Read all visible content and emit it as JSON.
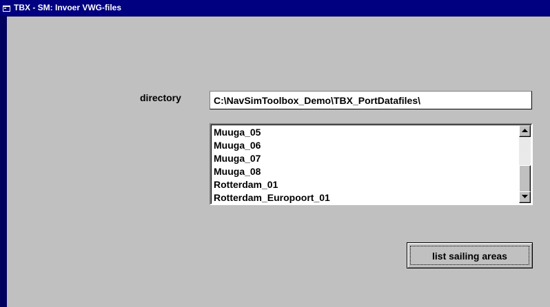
{
  "window": {
    "title": "TBX - SM: Invoer VWG-files",
    "icon": "app-window-icon"
  },
  "directory": {
    "label": "directory",
    "value": "C:\\NavSimToolbox_Demo\\TBX_PortDatafiles\\"
  },
  "sailing_area_list": {
    "items": [
      "Muuga_05",
      "Muuga_06",
      "Muuga_07",
      "Muuga_08",
      "Rotterdam_01",
      "Rotterdam_Europoort_01"
    ],
    "scrollbar": {
      "up_icon": "scroll-up-arrow-icon",
      "down_icon": "scroll-down-arrow-icon"
    }
  },
  "list_button": {
    "label": "list sailing areas"
  },
  "colors": {
    "titlebar": "#000080",
    "desktop": "#00005e",
    "face": "#c0c0c0",
    "field": "#ffffff"
  }
}
